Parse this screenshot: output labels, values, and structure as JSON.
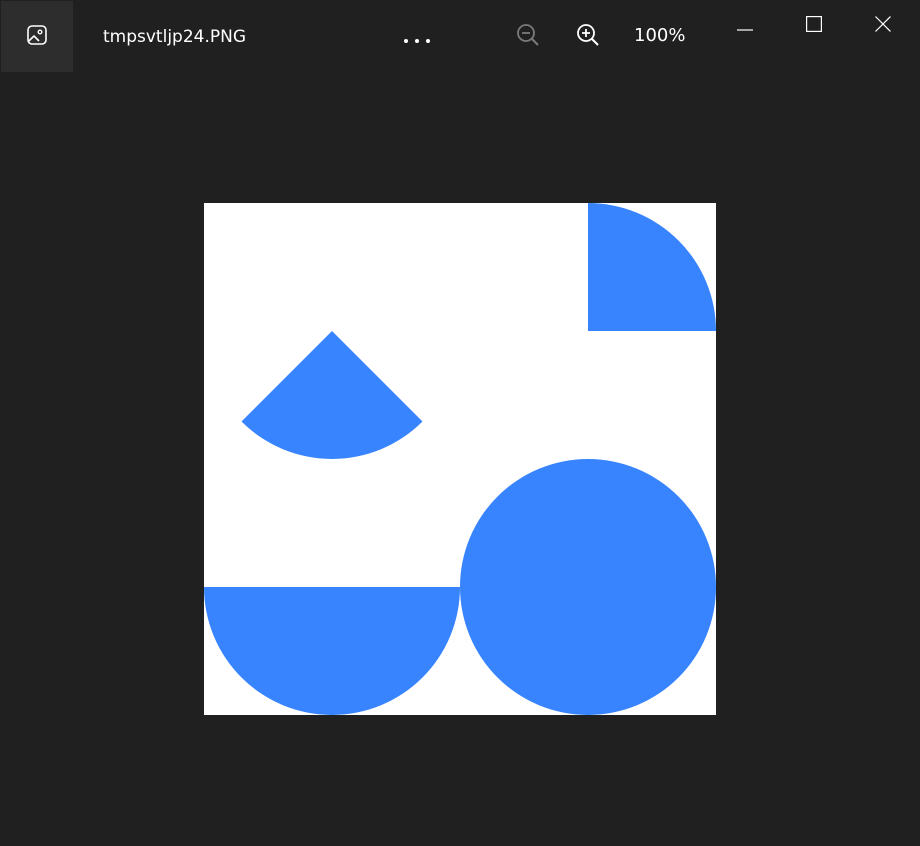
{
  "window": {
    "file_name": "tmpsvtljp24.PNG",
    "zoom_level": "100%"
  },
  "toolbar": {
    "app_icon": "photos-app-icon",
    "more_icon": "more-options-icon",
    "zoom_out_icon": "zoom-out-icon",
    "zoom_in_icon": "zoom-in-icon"
  },
  "window_controls": {
    "minimize_icon": "minimize-icon",
    "maximize_icon": "maximize-icon",
    "close_icon": "close-icon"
  },
  "image": {
    "background_color": "#ffffff",
    "shape_color": "#3884ff"
  },
  "colors": {
    "window_bg": "#202020",
    "titlebar_button_bg": "#2d2d2d",
    "text": "#ffffff",
    "disabled_icon": "#7a7a7a"
  }
}
